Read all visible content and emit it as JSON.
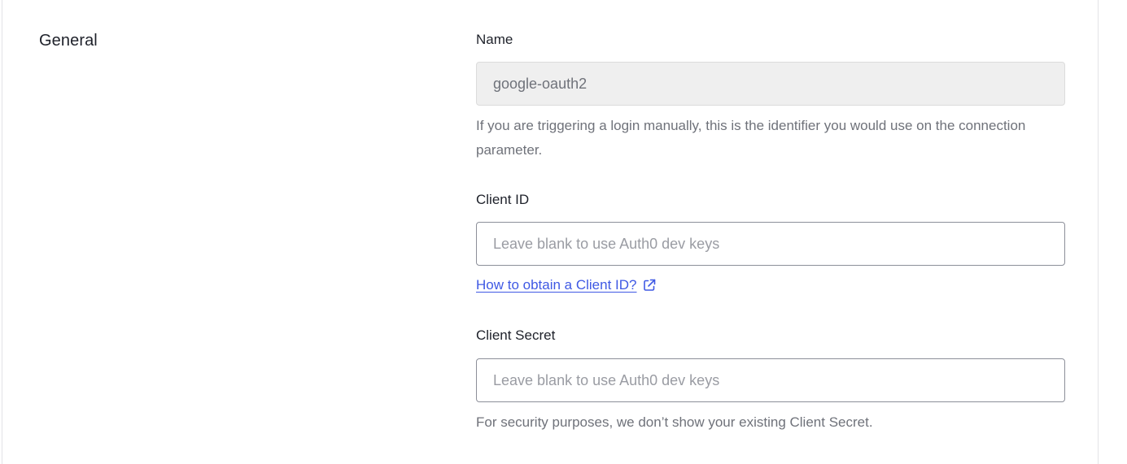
{
  "section": {
    "title": "General"
  },
  "name_field": {
    "label": "Name",
    "value": "google-oauth2",
    "help": "If you are triggering a login manually, this is the identifier you would use on the connection parameter."
  },
  "client_id_field": {
    "label": "Client ID",
    "placeholder": "Leave blank to use Auth0 dev keys",
    "value": "",
    "link_label": "How to obtain a Client ID?",
    "link_icon": "external-link-icon"
  },
  "client_secret_field": {
    "label": "Client Secret",
    "placeholder": "Leave blank to use Auth0 dev keys",
    "value": "",
    "help": "For security purposes, we don’t show your existing Client Secret."
  },
  "colors": {
    "link": "#3f59e4",
    "text": "#1e212a",
    "muted": "#6f727a",
    "disabled_bg": "#efefef"
  }
}
